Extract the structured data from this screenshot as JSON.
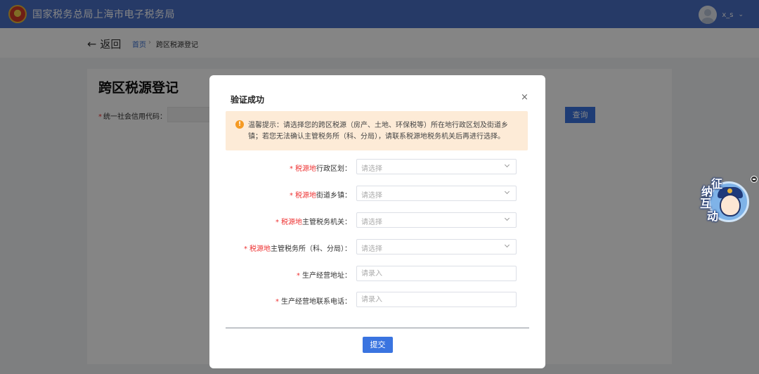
{
  "header": {
    "title": "国家税务总局上海市电子税务局",
    "user_name": "x_s",
    "caret": "⌄"
  },
  "breadcrumb": {
    "back_label": "返回",
    "back_arrow": "←",
    "home": "首页",
    "separator": "›",
    "current": "跨区税源登记"
  },
  "page": {
    "heading": "跨区税源登记",
    "credit_code_label": "统一社会信用代码：",
    "required_mark": "*",
    "query_button": "查询"
  },
  "mascot": {
    "chars": [
      "征",
      "纳",
      "互",
      "动"
    ]
  },
  "modal": {
    "title": "验证成功",
    "close": "×",
    "tip_icon": "!",
    "tip_text": "温馨提示：请选择您的跨区税源（房产、土地、环保税等）所在地行政区划及街道乡镇；若您无法确认主管税务所（科、分局），请联系税源地税务机关后再进行选择。",
    "fields": [
      {
        "highlight": "税源地",
        "label": "行政区划：",
        "placeholder": "请选择",
        "kind": "select"
      },
      {
        "highlight": "税源地",
        "label": "街道乡镇：",
        "placeholder": "请选择",
        "kind": "select"
      },
      {
        "highlight": "税源地",
        "label": "主管税务机关：",
        "placeholder": "请选择",
        "kind": "select"
      },
      {
        "highlight": "税源地",
        "label": "主管税务所（科、分局）：",
        "placeholder": "请选择",
        "kind": "select"
      },
      {
        "highlight": "",
        "label": "生产经营地址：",
        "placeholder": "请录入",
        "kind": "input"
      },
      {
        "highlight": "",
        "label": "生产经营地联系电话：",
        "placeholder": "请录入",
        "kind": "input"
      }
    ],
    "submit": "提交"
  },
  "colors": {
    "header_bg": "#4a6fc5",
    "primary": "#3a74e0",
    "required": "#e33333",
    "tip_bg": "#fdebd7",
    "tip_icon": "#f59a23"
  },
  "icons": {
    "emblem": "national-emblem-icon",
    "avatar": "user-avatar-icon",
    "back": "back-arrow-icon",
    "close": "close-icon",
    "tip": "warning-icon",
    "select": "chevron-down-icon",
    "mascot": "mascot-icon"
  }
}
